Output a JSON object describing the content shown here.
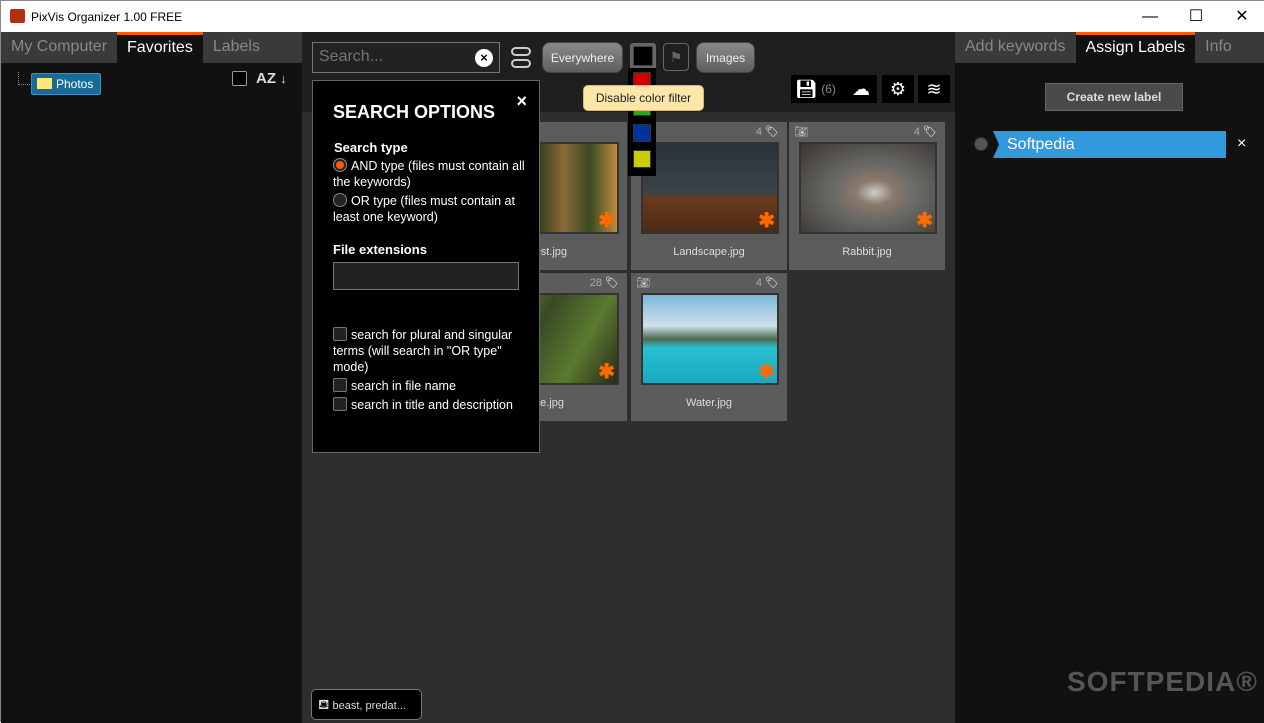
{
  "window": {
    "title": "PixVis Organizer 1.00 FREE",
    "minimize": "—",
    "maximize": "☐",
    "close": "✕"
  },
  "left_panel": {
    "tabs": [
      "My Computer",
      "Favorites",
      "Labels"
    ],
    "active_tab": "Favorites",
    "tree": [
      {
        "label": "Photos"
      }
    ],
    "sort_label": "AZ",
    "sort_arrow": "↓"
  },
  "toolbar": {
    "search_placeholder": "Search...",
    "search_value": "",
    "clear": "×",
    "scope": "Everywhere",
    "type": "Images",
    "save_count": "(6)",
    "tooltip": "Disable color filter",
    "color_filters": [
      "#000000",
      "#cc0000",
      "#22aa22",
      "#003399",
      "#cccc00"
    ]
  },
  "search_options": {
    "title": "SEARCH OPTIONS",
    "close": "×",
    "search_type_heading": "Search type",
    "and_label": "AND type (files must contain all the keywords)",
    "or_label": "OR type (files must contain at least one keyword)",
    "selected": "AND",
    "file_ext_heading": "File extensions",
    "file_ext_value": "",
    "checks": [
      "search for plural and singular terms (will search in \"OR type\" mode)",
      "search in file name",
      "search in title and description"
    ]
  },
  "tiles": [
    {
      "name": "Forest.jpg",
      "shown": "rest.jpg",
      "count": "",
      "camera": false
    },
    {
      "name": "Landscape.jpg",
      "shown": "Landscape.jpg",
      "count": "4",
      "camera": false
    },
    {
      "name": "Rabbit.jpg",
      "shown": "Rabbit.jpg",
      "count": "4",
      "camera": true
    },
    {
      "name": "Tree.jpg",
      "shown": "ee.jpg",
      "count": "28",
      "camera": false
    },
    {
      "name": "Water.jpg",
      "shown": "Water.jpg",
      "count": "4",
      "camera": true
    }
  ],
  "bottom_chip": "beast, predat...",
  "right_panel": {
    "tabs": [
      "Add keywords",
      "Assign Labels",
      "Info"
    ],
    "active_tab": "Assign Labels",
    "create_button": "Create new label",
    "labels": [
      {
        "name": "Softpedia",
        "color": "#3399dd"
      }
    ],
    "remove": "×"
  },
  "watermark": "SOFTPEDIA®",
  "accent": "#ff5a00"
}
